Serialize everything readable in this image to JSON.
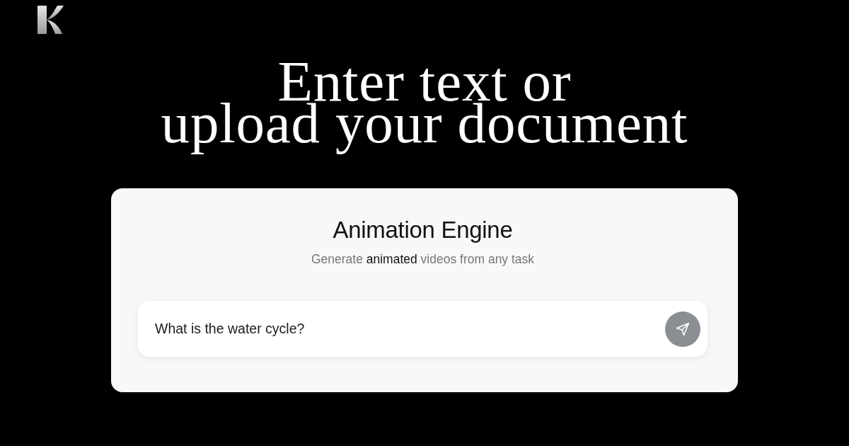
{
  "headline": [
    "Enter text or",
    "upload your document"
  ],
  "card": {
    "title": "Animation Engine",
    "subtitle": "Generate **animated** videos from any task",
    "prompt": {
      "value": "What is the water cycle?"
    }
  }
}
